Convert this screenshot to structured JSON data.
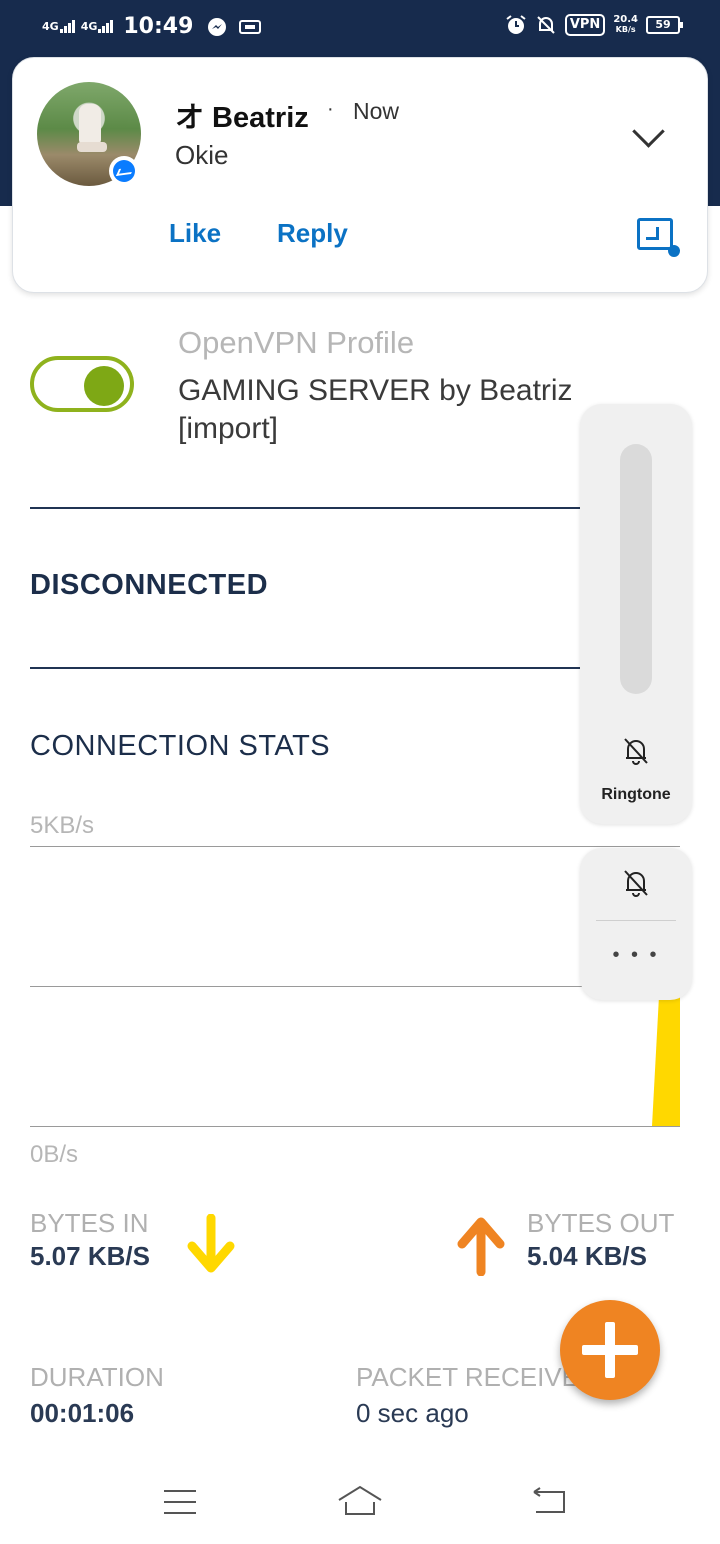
{
  "status_bar": {
    "sig1": "4G",
    "sig2": "4G",
    "time": "10:49",
    "vpn": "VPN",
    "speed_value": "20.4",
    "speed_unit": "KB/s",
    "battery": "59",
    "icons": [
      "messenger-icon",
      "alarm-icon",
      "bell-off-icon"
    ]
  },
  "notification": {
    "title": "オ Beatriz",
    "separator": "·",
    "time": "Now",
    "message": "Okie",
    "actions": {
      "like": "Like",
      "reply": "Reply"
    },
    "app": "messenger"
  },
  "profile": {
    "label": "OpenVPN Profile",
    "name": "GAMING SERVER by Beatriz [import]",
    "toggle_on": true,
    "toggle_color": "#7ea815"
  },
  "status": "DISCONNECTED",
  "stats": {
    "heading": "CONNECTION STATS",
    "axis_top": "5KB/s",
    "axis_bottom": "0B/s",
    "bytes_in_label": "BYTES IN",
    "bytes_in_value": "5.07 KB/S",
    "bytes_out_label": "BYTES OUT",
    "bytes_out_value": "5.04 KB/S",
    "duration_label": "DURATION",
    "duration_value": "00:01:06",
    "packet_label": "PACKET RECEIVE",
    "packet_value": "0 sec ago",
    "in_color": "#ffd800",
    "out_color": "#ef8422"
  },
  "volume_panel": {
    "label": "Ringtone",
    "more": "• • •"
  },
  "nav": {
    "icons": [
      "menu-icon",
      "home-icon",
      "back-icon"
    ]
  }
}
